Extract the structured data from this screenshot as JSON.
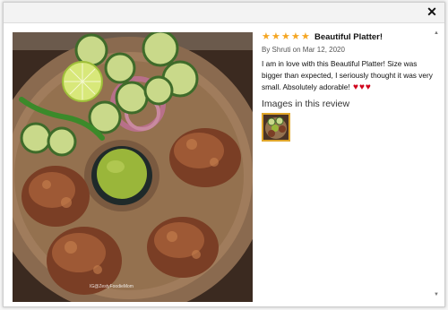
{
  "modal": {
    "close_label": "✕"
  },
  "photo": {
    "alt": "Kebab patties with green chutney, cucumber, lime and onion on a wooden platter",
    "watermark": "IG@ZestyFoodieMom"
  },
  "review": {
    "rating": 5,
    "star_glyph": "★",
    "title": "Beautiful Platter!",
    "byline": "By Shruti on Mar 12, 2020",
    "body": "I am in love with this Beautiful Platter! Size was bigger than expected, I seriously thought it was very small. Absolutely adorable!",
    "heart_glyph": "♥",
    "hearts": 3,
    "images_heading": "Images in this review"
  },
  "scrollbar": {
    "up": "▲",
    "down": "▼"
  },
  "colors": {
    "star": "#f5a623",
    "heart": "#d0021b",
    "thumb_border": "#e0a62a"
  }
}
